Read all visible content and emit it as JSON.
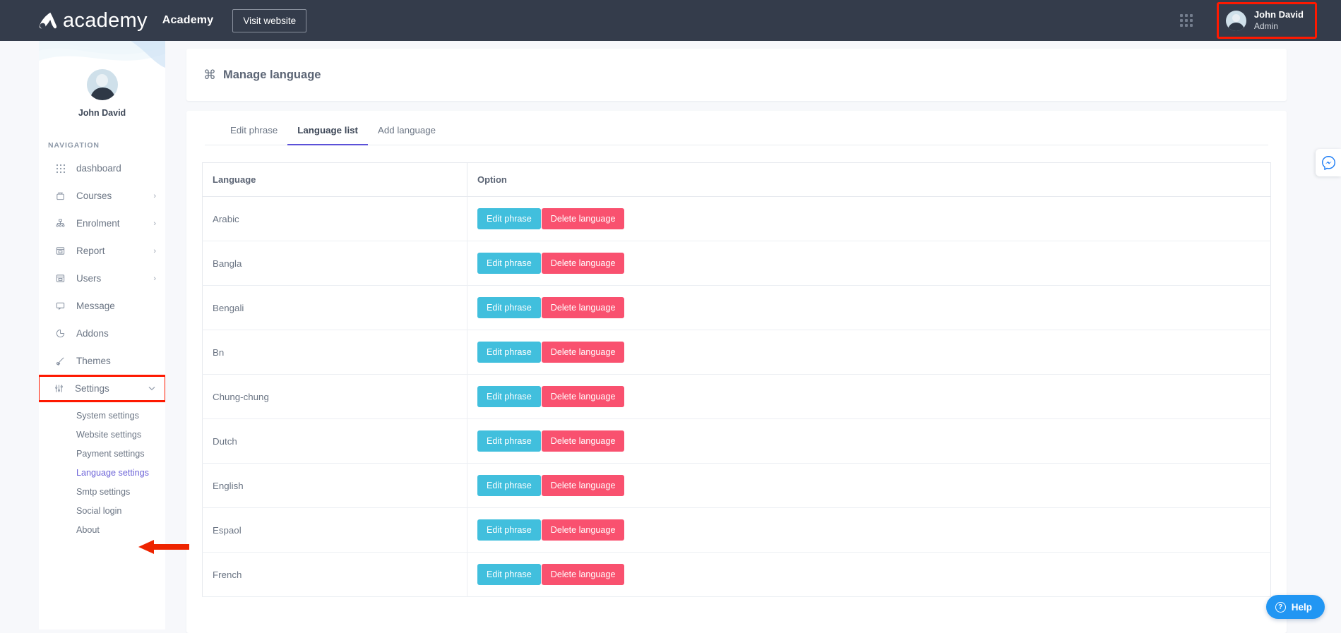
{
  "topbar": {
    "logo_word": "academy",
    "brand_name": "Academy",
    "visit_button": "Visit website",
    "grid_icon": "apps-grid-icon",
    "user": {
      "name": "John David",
      "role": "Admin",
      "highlight_color": "#fe1900"
    }
  },
  "sidebar": {
    "profile_name": "John David",
    "nav_label": "NAVIGATION",
    "items": [
      {
        "label": "dashboard",
        "icon": "grid-dots-icon",
        "chevron": ""
      },
      {
        "label": "Courses",
        "icon": "basket-icon",
        "chevron": "›"
      },
      {
        "label": "Enrolment",
        "icon": "sitemap-icon",
        "chevron": "›"
      },
      {
        "label": "Report",
        "icon": "archive-icon",
        "chevron": "›"
      },
      {
        "label": "Users",
        "icon": "archive-icon",
        "chevron": "›"
      },
      {
        "label": "Message",
        "icon": "chat-bubble-icon",
        "chevron": ""
      },
      {
        "label": "Addons",
        "icon": "pie-chart-icon",
        "chevron": ""
      },
      {
        "label": "Themes",
        "icon": "brush-icon",
        "chevron": ""
      },
      {
        "label": "Settings",
        "icon": "sliders-icon",
        "chevron": "⌄",
        "highlighted": true
      }
    ],
    "sub_items": [
      {
        "label": "System settings",
        "active": false
      },
      {
        "label": "Website settings",
        "active": false
      },
      {
        "label": "Payment settings",
        "active": false
      },
      {
        "label": "Language settings",
        "active": true
      },
      {
        "label": "Smtp settings",
        "active": false
      },
      {
        "label": "Social login",
        "active": false
      },
      {
        "label": "About",
        "active": false
      }
    ],
    "active_color": "#6c63d8"
  },
  "main": {
    "page_icon": "⌘",
    "page_title": "Manage language",
    "tabs": [
      {
        "label": "Edit phrase",
        "active": false
      },
      {
        "label": "Language list",
        "active": true
      },
      {
        "label": "Add language",
        "active": false
      }
    ],
    "table": {
      "headers": [
        "Language",
        "Option"
      ],
      "edit_label": "Edit phrase",
      "delete_label": "Delete language",
      "edit_color": "#41bfdd",
      "delete_color": "#f9516f",
      "rows": [
        {
          "language": "Arabic"
        },
        {
          "language": "Bangla"
        },
        {
          "language": "Bengali"
        },
        {
          "language": "Bn"
        },
        {
          "language": "Chung-chung"
        },
        {
          "language": "Dutch"
        },
        {
          "language": "English"
        },
        {
          "language": "Espaol"
        },
        {
          "language": "French"
        }
      ]
    }
  },
  "floaters": {
    "chat_icon": "messenger-icon",
    "help_label": "Help",
    "help_icon": "question-mark-icon"
  }
}
